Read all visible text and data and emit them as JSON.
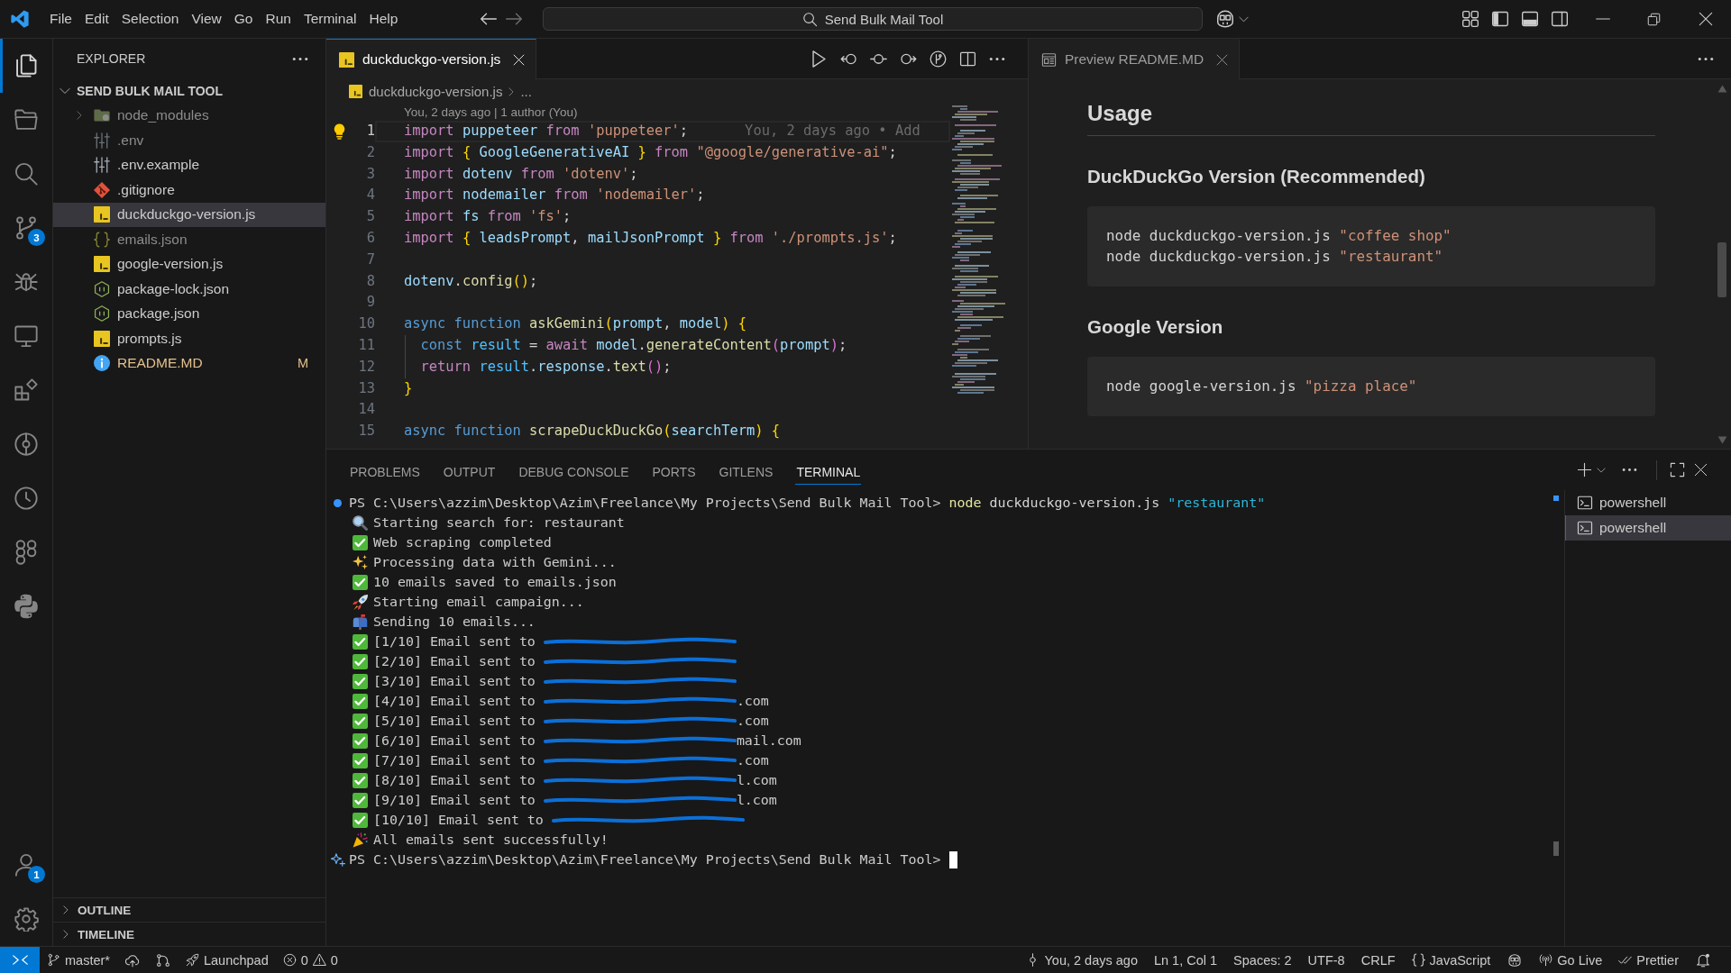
{
  "title_bar": {
    "menu": [
      "File",
      "Edit",
      "Selection",
      "View",
      "Go",
      "Run",
      "Terminal",
      "Help"
    ],
    "command_center": "Send Bulk Mail Tool"
  },
  "activity_bar": {
    "items": [
      {
        "kind": "explorer",
        "selected": true
      },
      {
        "kind": "folders",
        "selected": false
      },
      {
        "kind": "search",
        "selected": false
      },
      {
        "kind": "source-control",
        "selected": false,
        "badge": "3"
      },
      {
        "kind": "debug",
        "selected": false
      },
      {
        "kind": "remote",
        "selected": false
      },
      {
        "kind": "extensions",
        "selected": false
      },
      {
        "kind": "gitlens",
        "selected": false
      },
      {
        "kind": "history",
        "selected": false
      },
      {
        "kind": "nodes",
        "selected": false
      },
      {
        "kind": "python",
        "selected": false
      }
    ],
    "bottom": [
      {
        "kind": "account",
        "badge": "1"
      },
      {
        "kind": "settings"
      }
    ]
  },
  "sidebar": {
    "title": "EXPLORER",
    "folder": {
      "name": "SEND BULK MAIL TOOL",
      "expanded": true,
      "items": [
        {
          "name": "node_modules",
          "kind": "folder",
          "expanded": false,
          "selected": false,
          "ignored": true,
          "modified": false
        },
        {
          "name": ".env",
          "kind": "env",
          "selected": false,
          "ignored": true,
          "modified": false
        },
        {
          "name": ".env.example",
          "kind": "env",
          "selected": false,
          "ignored": false,
          "modified": false
        },
        {
          "name": ".gitignore",
          "kind": "git",
          "selected": false,
          "ignored": false,
          "modified": false
        },
        {
          "name": "duckduckgo-version.js",
          "kind": "js",
          "selected": true,
          "ignored": false,
          "modified": false
        },
        {
          "name": "emails.json",
          "kind": "json",
          "selected": false,
          "ignored": true,
          "modified": false
        },
        {
          "name": "google-version.js",
          "kind": "js",
          "selected": false,
          "ignored": false,
          "modified": false
        },
        {
          "name": "package-lock.json",
          "kind": "npm",
          "selected": false,
          "ignored": false,
          "modified": false
        },
        {
          "name": "package.json",
          "kind": "npm",
          "selected": false,
          "ignored": false,
          "modified": false
        },
        {
          "name": "prompts.js",
          "kind": "js",
          "selected": false,
          "ignored": false,
          "modified": false
        },
        {
          "name": "README.MD",
          "kind": "info",
          "selected": false,
          "ignored": false,
          "modified": true,
          "badge": "M"
        }
      ]
    },
    "sections": [
      {
        "title": "OUTLINE",
        "expanded": false
      },
      {
        "title": "TIMELINE",
        "expanded": false
      }
    ]
  },
  "editor": {
    "focused": true,
    "tabs": [
      {
        "label": "duckduckgo-version.js",
        "kind": "js",
        "selected": true
      }
    ],
    "breadcrumb": [
      {
        "label": "duckduckgo-version.js",
        "kind": "js"
      },
      {
        "label": "..."
      }
    ],
    "codelens": "You, 2 days ago | 1 author (You)",
    "lines": [
      {
        "number": "1",
        "active": true,
        "indent_guide": false,
        "blame": "You, 2 days ago • Add",
        "tokens": [
          {
            "text": "import ",
            "kind": "keyword"
          },
          {
            "text": "puppeteer ",
            "kind": "variable"
          },
          {
            "text": "from ",
            "kind": "keyword"
          },
          {
            "text": "'puppeteer'",
            "kind": "string"
          },
          {
            "text": ";",
            "kind": "plain"
          }
        ]
      },
      {
        "number": "2",
        "active": false,
        "indent_guide": false,
        "tokens": [
          {
            "text": "import ",
            "kind": "keyword"
          },
          {
            "text": "{",
            "kind": "bracket1"
          },
          {
            "text": " GoogleGenerativeAI ",
            "kind": "variable"
          },
          {
            "text": "}",
            "kind": "bracket1"
          },
          {
            "text": " from ",
            "kind": "keyword"
          },
          {
            "text": "\"@google/generative-ai\"",
            "kind": "string"
          },
          {
            "text": ";",
            "kind": "plain"
          }
        ]
      },
      {
        "number": "3",
        "active": false,
        "indent_guide": false,
        "tokens": [
          {
            "text": "import ",
            "kind": "keyword"
          },
          {
            "text": "dotenv ",
            "kind": "variable"
          },
          {
            "text": "from ",
            "kind": "keyword"
          },
          {
            "text": "'dotenv'",
            "kind": "string"
          },
          {
            "text": ";",
            "kind": "plain"
          }
        ]
      },
      {
        "number": "4",
        "active": false,
        "indent_guide": false,
        "tokens": [
          {
            "text": "import ",
            "kind": "keyword"
          },
          {
            "text": "nodemailer ",
            "kind": "variable"
          },
          {
            "text": "from ",
            "kind": "keyword"
          },
          {
            "text": "'nodemailer'",
            "kind": "string"
          },
          {
            "text": ";",
            "kind": "plain"
          }
        ]
      },
      {
        "number": "5",
        "active": false,
        "indent_guide": false,
        "tokens": [
          {
            "text": "import ",
            "kind": "keyword"
          },
          {
            "text": "fs ",
            "kind": "variable"
          },
          {
            "text": "from ",
            "kind": "keyword"
          },
          {
            "text": "'fs'",
            "kind": "string"
          },
          {
            "text": ";",
            "kind": "plain"
          }
        ]
      },
      {
        "number": "6",
        "active": false,
        "indent_guide": false,
        "tokens": [
          {
            "text": "import ",
            "kind": "keyword"
          },
          {
            "text": "{",
            "kind": "bracket1"
          },
          {
            "text": " leadsPrompt",
            "kind": "variable"
          },
          {
            "text": ", ",
            "kind": "plain"
          },
          {
            "text": "mailJsonPrompt ",
            "kind": "variable"
          },
          {
            "text": "}",
            "kind": "bracket1"
          },
          {
            "text": " from ",
            "kind": "keyword"
          },
          {
            "text": "'./prompts.js'",
            "kind": "string"
          },
          {
            "text": ";",
            "kind": "plain"
          }
        ]
      },
      {
        "number": "7",
        "active": false,
        "indent_guide": false
      },
      {
        "number": "8",
        "active": false,
        "indent_guide": false,
        "tokens": [
          {
            "text": "dotenv",
            "kind": "variable"
          },
          {
            "text": ".",
            "kind": "plain"
          },
          {
            "text": "config",
            "kind": "function"
          },
          {
            "text": "()",
            "kind": "bracket1"
          },
          {
            "text": ";",
            "kind": "plain"
          }
        ]
      },
      {
        "number": "9",
        "active": false,
        "indent_guide": false
      },
      {
        "number": "10",
        "active": false,
        "indent_guide": false,
        "tokens": [
          {
            "text": "async function ",
            "kind": "storage"
          },
          {
            "text": "askGemini",
            "kind": "function"
          },
          {
            "text": "(",
            "kind": "bracket1"
          },
          {
            "text": "prompt",
            "kind": "variable"
          },
          {
            "text": ", ",
            "kind": "plain"
          },
          {
            "text": "model",
            "kind": "variable"
          },
          {
            "text": ") {",
            "kind": "bracket1"
          }
        ]
      },
      {
        "number": "11",
        "active": false,
        "indent_guide": true,
        "tokens": [
          {
            "text": "  const ",
            "kind": "storage"
          },
          {
            "text": "result",
            "kind": "constant"
          },
          {
            "text": " = ",
            "kind": "plain"
          },
          {
            "text": "await ",
            "kind": "keyword"
          },
          {
            "text": "model",
            "kind": "variable"
          },
          {
            "text": ".",
            "kind": "plain"
          },
          {
            "text": "generateContent",
            "kind": "function"
          },
          {
            "text": "(",
            "kind": "bracket2"
          },
          {
            "text": "prompt",
            "kind": "variable"
          },
          {
            "text": ")",
            "kind": "bracket2"
          },
          {
            "text": ";",
            "kind": "plain"
          }
        ]
      },
      {
        "number": "12",
        "active": false,
        "indent_guide": true,
        "tokens": [
          {
            "text": "  return ",
            "kind": "keyword"
          },
          {
            "text": "result",
            "kind": "constant"
          },
          {
            "text": ".",
            "kind": "plain"
          },
          {
            "text": "response",
            "kind": "variable"
          },
          {
            "text": ".",
            "kind": "plain"
          },
          {
            "text": "text",
            "kind": "function"
          },
          {
            "text": "()",
            "kind": "bracket2"
          },
          {
            "text": ";",
            "kind": "plain"
          }
        ]
      },
      {
        "number": "13",
        "active": false,
        "indent_guide": false,
        "tokens": [
          {
            "text": "}",
            "kind": "bracket1"
          }
        ]
      },
      {
        "number": "14",
        "active": false,
        "indent_guide": false
      },
      {
        "number": "15",
        "active": false,
        "indent_guide": false,
        "tokens": [
          {
            "text": "async function ",
            "kind": "storage"
          },
          {
            "text": "scrapeDuckDuckGo",
            "kind": "function"
          },
          {
            "text": "(",
            "kind": "bracket1"
          },
          {
            "text": "searchTerm",
            "kind": "variable"
          },
          {
            "text": ") {",
            "kind": "bracket1"
          }
        ]
      }
    ]
  },
  "preview": {
    "focused": false,
    "tab": {
      "label": "Preview README.MD",
      "selected": true
    },
    "blocks": [
      {
        "kind": "h2",
        "text": "Usage"
      },
      {
        "kind": "h3",
        "text": "DuckDuckGo Version (Recommended)"
      },
      {
        "kind": "code",
        "lines": [
          [
            {
              "text": "node duckduckgo-version.js ",
              "kind": "plain"
            },
            {
              "text": "\"coffee shop\"",
              "kind": "string"
            }
          ],
          [
            {
              "text": "node duckduckgo-version.js ",
              "kind": "plain"
            },
            {
              "text": "\"restaurant\"",
              "kind": "string"
            }
          ]
        ]
      },
      {
        "kind": "h3",
        "text": "Google Version"
      },
      {
        "kind": "code",
        "lines": [
          [
            {
              "text": "node google-version.js ",
              "kind": "plain"
            },
            {
              "text": "\"pizza place\"",
              "kind": "string"
            }
          ]
        ]
      }
    ]
  },
  "panel": {
    "tabs": [
      {
        "label": "PROBLEMS",
        "selected": false
      },
      {
        "label": "OUTPUT",
        "selected": false
      },
      {
        "label": "DEBUG CONSOLE",
        "selected": false
      },
      {
        "label": "PORTS",
        "selected": false
      },
      {
        "label": "GITLENS",
        "selected": false
      },
      {
        "label": "TERMINAL",
        "selected": true
      }
    ],
    "terminal": {
      "lines": [
        {
          "kind": "prompt",
          "cursor": false,
          "prompt": "PS C:\\Users\\azzim\\Desktop\\Azim\\Freelance\\My Projects\\Send Bulk Mail Tool>",
          "command": [
            {
              "text": "node ",
              "kind": "command"
            },
            {
              "text": "duckduckgo-version.js ",
              "kind": "plain"
            },
            {
              "text": "\"restaurant\"",
              "kind": "argument"
            }
          ]
        },
        {
          "kind": "search",
          "redacted": false,
          "text": "Starting search for: restaurant"
        },
        {
          "kind": "success",
          "redacted": false,
          "text": "Web scraping completed"
        },
        {
          "kind": "sparkle",
          "redacted": false,
          "text": "Processing data with Gemini..."
        },
        {
          "kind": "success",
          "redacted": false,
          "text": "10 emails saved to emails.json"
        },
        {
          "kind": "rocket",
          "redacted": false,
          "text": "Starting email campaign..."
        },
        {
          "kind": "mailbox",
          "redacted": false,
          "text": "Sending 10 emails..."
        },
        {
          "kind": "success",
          "redacted": true,
          "text": "[1/10] Email sent to"
        },
        {
          "kind": "success",
          "redacted": true,
          "text": "[2/10] Email sent to"
        },
        {
          "kind": "success",
          "redacted": true,
          "text": "[3/10] Email sent to"
        },
        {
          "kind": "success",
          "redacted": true,
          "text": "[4/10] Email sent to",
          "tail": ".com"
        },
        {
          "kind": "success",
          "redacted": true,
          "text": "[5/10] Email sent to",
          "tail": ".com"
        },
        {
          "kind": "success",
          "redacted": true,
          "text": "[6/10] Email sent to",
          "tail": "mail.com"
        },
        {
          "kind": "success",
          "redacted": true,
          "text": "[7/10] Email sent to",
          "tail": ".com"
        },
        {
          "kind": "success",
          "redacted": true,
          "text": "[8/10] Email sent to",
          "tail": "l.com"
        },
        {
          "kind": "success",
          "redacted": true,
          "text": "[9/10] Email sent to",
          "tail": "l.com"
        },
        {
          "kind": "success",
          "redacted": true,
          "text": "[10/10] Email sent to"
        },
        {
          "kind": "party",
          "redacted": false,
          "text": "All emails sent successfully!"
        },
        {
          "kind": "input",
          "cursor": true,
          "prompt": "PS C:\\Users\\azzim\\Desktop\\Azim\\Freelance\\My Projects\\Send Bulk Mail Tool>"
        }
      ]
    },
    "sessions": [
      {
        "label": "powershell",
        "selected": false
      },
      {
        "label": "powershell",
        "selected": true
      }
    ]
  },
  "status_bar": {
    "left": [
      {
        "kind": "remote"
      },
      {
        "kind": "branch",
        "text": "master*"
      },
      {
        "kind": "sync"
      },
      {
        "kind": "graph"
      },
      {
        "kind": "launchpad",
        "text": "Launchpad"
      },
      {
        "kind": "problems",
        "errors": "0",
        "warnings": "0"
      }
    ],
    "right": [
      {
        "kind": "blame",
        "text": "You, 2 days ago"
      },
      {
        "kind": "text",
        "text": "Ln 1, Col 1"
      },
      {
        "kind": "text",
        "text": "Spaces: 2"
      },
      {
        "kind": "text",
        "text": "UTF-8"
      },
      {
        "kind": "text",
        "text": "CRLF"
      },
      {
        "kind": "language",
        "text": "JavaScript"
      },
      {
        "kind": "copilot"
      },
      {
        "kind": "live",
        "text": "Go Live"
      },
      {
        "kind": "prettier",
        "text": "Prettier"
      },
      {
        "kind": "bell"
      }
    ]
  }
}
